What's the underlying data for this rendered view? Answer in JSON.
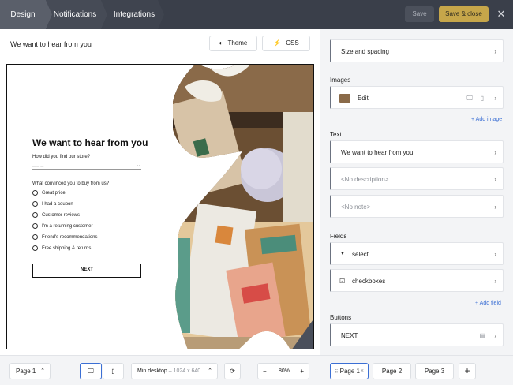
{
  "topbar": {
    "tabs": [
      {
        "label": "Design"
      },
      {
        "label": "Notifications"
      },
      {
        "label": "Integrations"
      }
    ],
    "save_label": "Save",
    "save_close_label": "Save & close",
    "close_glyph": "✕"
  },
  "editor": {
    "title": "We want to hear from you",
    "theme_label": "Theme",
    "css_label": "CSS"
  },
  "form": {
    "title": "We want to hear from you",
    "question1": "How did you find our store?",
    "select_placeholder": "— — —",
    "question2": "What convinced you to buy from us?",
    "options": [
      "Great price",
      "I had a coupon",
      "Customer reviews",
      "I'm a returning customer",
      "Friend's recommendations",
      "Free shipping & returns"
    ],
    "next_label": "NEXT"
  },
  "bottombar": {
    "page_select": "Page 1",
    "viewport_label": "Min desktop",
    "viewport_size": "1024 x 640",
    "zoom": "80%"
  },
  "panel": {
    "size_spacing": "Size and spacing",
    "images_title": "Images",
    "image_edit": "Edit",
    "add_image": "+ Add image",
    "text_title": "Text",
    "text_items": [
      "We want to hear from you",
      "<No description>",
      "<No note>"
    ],
    "fields_title": "Fields",
    "field_items": [
      "select",
      "checkboxes"
    ],
    "add_field": "+ Add field",
    "buttons_title": "Buttons",
    "button_items": [
      "NEXT"
    ],
    "pages": [
      "Page 1",
      "Page 2",
      "Page 3"
    ]
  },
  "colors": {
    "topbar": "#3a3f4a",
    "accent_gold": "#c6a64a",
    "link_blue": "#3b6fd4",
    "selected_blue": "#3b6fd4"
  }
}
